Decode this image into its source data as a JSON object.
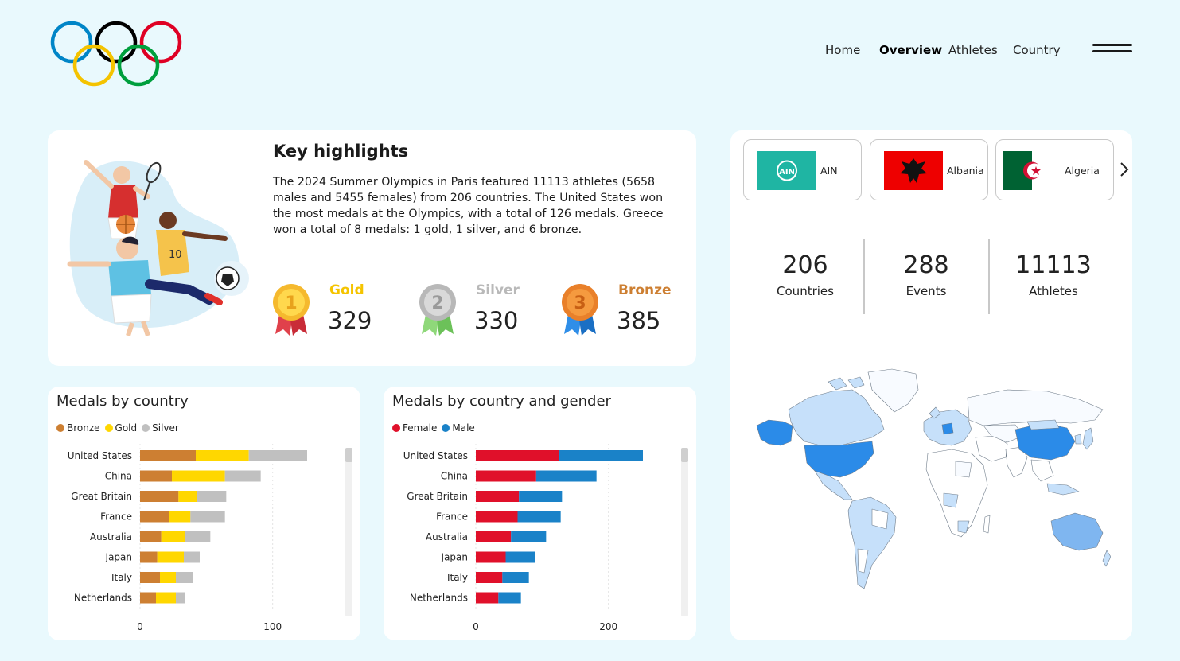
{
  "nav": {
    "items": [
      {
        "label": "Home",
        "active": false
      },
      {
        "label": "Overview",
        "active": true
      },
      {
        "label": "Athletes",
        "active": false
      },
      {
        "label": "Country",
        "active": false
      }
    ]
  },
  "highlights": {
    "title": "Key highlights",
    "text": "The 2024 Summer Olympics in Paris featured 11113 athletes (5658 males and 5455 females) from 206 countries. The United States won the most medals at the Olympics, with a total of 126 medals. Greece won a total of 8 medals: 1 gold, 1 silver, and 6 bronze.",
    "medals": [
      {
        "name": "Gold",
        "count": "329",
        "name_color": "#f5c400",
        "number": "1"
      },
      {
        "name": "Silver",
        "count": "330",
        "name_color": "#b9b9b9",
        "number": "2"
      },
      {
        "name": "Bronze",
        "count": "385",
        "name_color": "#cd7f32",
        "number": "3"
      }
    ]
  },
  "flags": [
    {
      "label": "AIN"
    },
    {
      "label": "Albania"
    },
    {
      "label": "Algeria"
    }
  ],
  "stats": [
    {
      "value": "206",
      "label": "Countries"
    },
    {
      "value": "288",
      "label": "Events"
    },
    {
      "value": "11113",
      "label": "Athletes"
    }
  ],
  "colors": {
    "bronze": "#cd7f32",
    "gold": "#ffd700",
    "silver": "#c0c0c0",
    "female": "#e0102a",
    "male": "#1a82c8"
  },
  "chart_data": [
    {
      "type": "bar",
      "orientation": "horizontal",
      "stacked": true,
      "title": "Medals by country",
      "categories": [
        "United States",
        "China",
        "Great Britain",
        "France",
        "Australia",
        "Japan",
        "Italy",
        "Netherlands"
      ],
      "series": [
        {
          "name": "Bronze",
          "values": [
            42,
            24,
            29,
            22,
            16,
            13,
            15,
            12
          ]
        },
        {
          "name": "Gold",
          "values": [
            40,
            40,
            14,
            16,
            18,
            20,
            12,
            15
          ]
        },
        {
          "name": "Silver",
          "values": [
            44,
            27,
            22,
            26,
            19,
            12,
            13,
            7
          ]
        }
      ],
      "xticks": [
        "0",
        "100"
      ],
      "xlim": [
        0,
        150
      ],
      "legend": "top-left"
    },
    {
      "type": "bar",
      "orientation": "horizontal",
      "stacked": true,
      "title": "Medals by country and gender",
      "categories": [
        "United States",
        "China",
        "Great Britain",
        "France",
        "Australia",
        "Japan",
        "Italy",
        "Netherlands"
      ],
      "series": [
        {
          "name": "Female",
          "values": [
            126,
            91,
            65,
            63,
            53,
            45,
            40,
            34
          ]
        },
        {
          "name": "Male",
          "values": [
            126,
            91,
            65,
            65,
            53,
            45,
            40,
            34
          ]
        }
      ],
      "xticks": [
        "0",
        "200"
      ],
      "xlim": [
        0,
        300
      ],
      "legend": "top-left"
    }
  ]
}
